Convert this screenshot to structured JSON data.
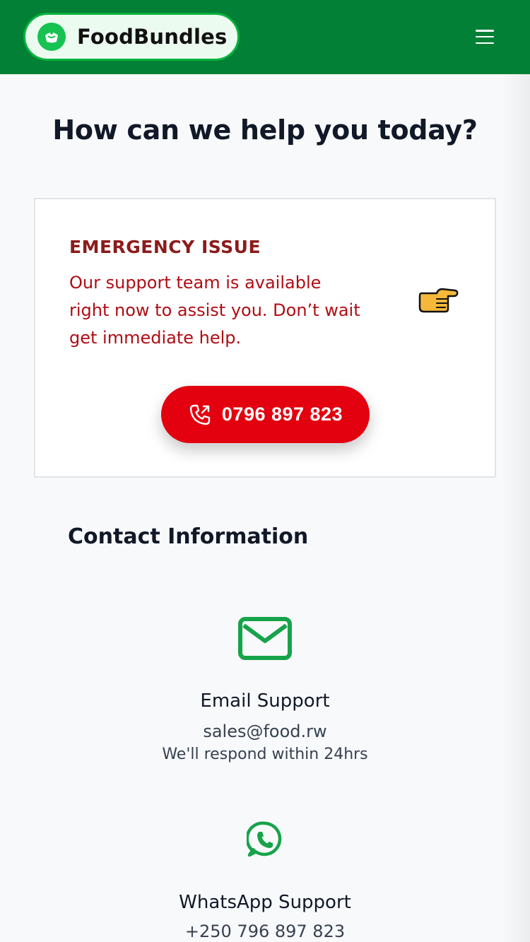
{
  "header": {
    "brand_name": "FoodBundles",
    "colors": {
      "bar": "#028036",
      "brand_bg": "#ecfbef",
      "brand_icon": "#16c252"
    }
  },
  "page": {
    "title": "How can we help you today?"
  },
  "emergency": {
    "title": "EMERGENCY ISSUE",
    "text": "Our support team is available right now to assist you. Don’t wait get immediate help.",
    "phone": "0796 897 823",
    "icons": {
      "pointer": "pointing-hand-icon",
      "call": "phone-call-icon"
    },
    "colors": {
      "title": "#8b1b1b",
      "text": "#b00d14",
      "button": "#e3000f"
    }
  },
  "contact": {
    "title": "Contact Information",
    "items": [
      {
        "icon": "mail-icon",
        "name": "Email Support",
        "value": "sales@food.rw",
        "note": "We'll respond within 24hrs"
      },
      {
        "icon": "whatsapp-icon",
        "name": "WhatsApp Support",
        "value": "+250 796 897 823"
      }
    ],
    "accent_color": "#16a34a"
  }
}
